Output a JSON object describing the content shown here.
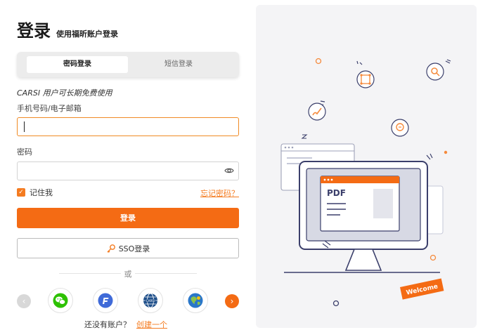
{
  "header": {
    "title": "登录",
    "subtitle": "使用福昕账户登录"
  },
  "tabs": [
    {
      "label": "密码登录",
      "active": true
    },
    {
      "label": "短信登录",
      "active": false
    }
  ],
  "form": {
    "carsi_note": "CARSI 用户可长期免费使用",
    "account_label": "手机号码/电子邮箱",
    "account_value": "",
    "password_label": "密码",
    "password_value": "",
    "remember_label": "记住我",
    "remember_checked": true,
    "forgot_label": "忘记密码？",
    "login_button": "登录",
    "sso_button": "SSO登录"
  },
  "divider_text": "或",
  "social_logins": [
    "wechat-icon",
    "foxit-icon",
    "carsi-icon",
    "globe-icon"
  ],
  "register": {
    "prompt": "还没有账户？",
    "link": "创建一个"
  },
  "illustration": {
    "pdf_label": "PDF",
    "welcome_label": "Welcome"
  },
  "colors": {
    "accent": "#f46b14",
    "link": "#f47b20",
    "panel_bg": "#f4f4f6"
  }
}
